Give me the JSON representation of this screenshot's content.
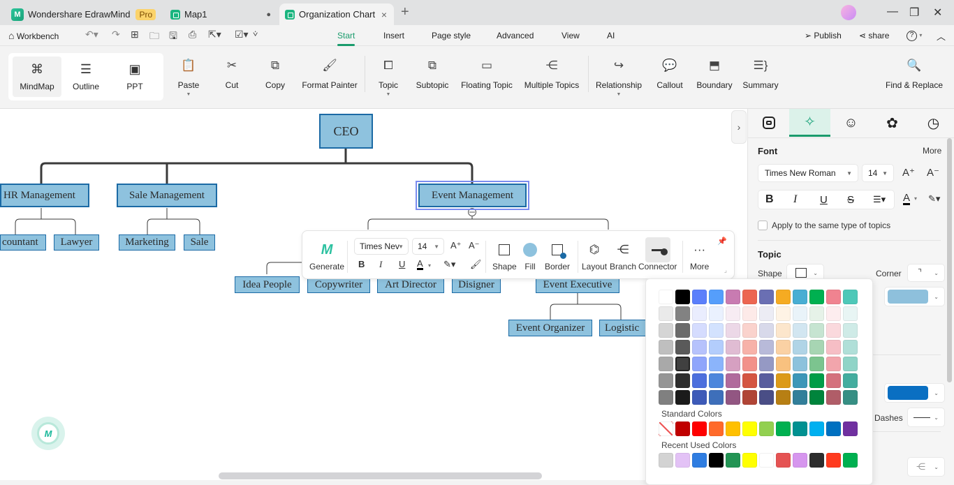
{
  "titlebar": {
    "app_name": "Wondershare EdrawMind",
    "app_badge": "Pro",
    "tabs": [
      {
        "label": "Map1",
        "unsaved_dot": "●"
      },
      {
        "label": "Organization Chart",
        "close": "×"
      }
    ],
    "new_tab": "+",
    "window": {
      "minimize": "—",
      "restore": "❐",
      "close": "✕"
    }
  },
  "menubar": {
    "workbench": "Workbench",
    "menus": [
      "Start",
      "Insert",
      "Page style",
      "Advanced",
      "View",
      "AI"
    ],
    "active_menu": "Start",
    "publish": "Publish",
    "share": "share",
    "help": "?"
  },
  "ribbon": {
    "views": [
      {
        "label": "MindMap",
        "icon": "mindmap-icon",
        "glyph": "⌘"
      },
      {
        "label": "Outline",
        "icon": "outline-icon",
        "glyph": "☰"
      },
      {
        "label": "PPT",
        "icon": "ppt-icon",
        "glyph": "▣"
      }
    ],
    "active_view": "MindMap",
    "tools": [
      {
        "label": "Paste",
        "glyph": "📋",
        "dropdown": true
      },
      {
        "label": "Cut",
        "glyph": "✂"
      },
      {
        "label": "Copy",
        "glyph": "⧉"
      },
      {
        "label": "Format Painter",
        "glyph": "🖌"
      },
      {
        "label": "Topic",
        "glyph": "⧠",
        "dropdown": true
      },
      {
        "label": "Subtopic",
        "glyph": "⧉"
      },
      {
        "label": "Floating Topic",
        "glyph": "▭"
      },
      {
        "label": "Multiple Topics",
        "glyph": "⋲"
      },
      {
        "label": "Relationship",
        "glyph": "↪",
        "dropdown": true
      },
      {
        "label": "Callout",
        "glyph": "💬"
      },
      {
        "label": "Boundary",
        "glyph": "⬒"
      },
      {
        "label": "Summary",
        "glyph": "☰}"
      },
      {
        "label": "Find & Replace",
        "glyph": "🔍"
      }
    ]
  },
  "canvas": {
    "nodes": {
      "ceo": "CEO",
      "hr": "HR Management",
      "sale_mgmt": "Sale Management",
      "event_mgmt": "Event Management",
      "accountant": "countant",
      "lawyer": "Lawyer",
      "marketing": "Marketing",
      "sale": "Sale",
      "idea_people": "Idea People",
      "copywriter": "Copywriter",
      "art_director": "Art Director",
      "designer": "Disigner",
      "event_exec": "Event Executive",
      "event_org": "Event Organizer",
      "logistic": "Logistic"
    },
    "selected_node": "Event Management"
  },
  "floating_toolbar": {
    "generate": "Generate",
    "font": "Times Nev",
    "size": "14",
    "bold": "B",
    "italic": "I",
    "underline": "U",
    "font_color": "A",
    "grow": "A⁺",
    "shrink": "A⁻",
    "shape": "Shape",
    "fill": "Fill",
    "border": "Border",
    "layout": "Layout",
    "branch": "Branch",
    "connector": "Connector",
    "more": "More",
    "more_glyph": "···"
  },
  "right_panel": {
    "font_section": {
      "title": "Font",
      "more": "More",
      "font_family": "Times New Roman",
      "font_size": "14",
      "bold": "B",
      "italic": "I",
      "underline": "U",
      "strike": "S",
      "apply_same": "Apply to the same type of topics",
      "apply_same_checked": false
    },
    "topic_section": {
      "title": "Topic",
      "shape_label": "Shape",
      "corner_label": "Corner",
      "fill_color": "#8ec0dc",
      "line_color": "#0a6fc2",
      "dashes_label": "Dashes"
    }
  },
  "color_picker": {
    "theme_colors": [
      [
        "#ffffff",
        "#000000",
        "#5b7ffb",
        "#559efb",
        "#c87bb1",
        "#ec6651",
        "#6a6fb3",
        "#f5ab22",
        "#48aed3",
        "#00b050",
        "#f08390",
        "#4ec8b8"
      ],
      [
        "#eaeaea",
        "#828282",
        "#eaedfe",
        "#eaf1fe",
        "#f7ecf3",
        "#fdeae8",
        "#ececf4",
        "#fef3e5",
        "#e9f3f9",
        "#e6f2e8",
        "#fdedef",
        "#e8f5f4"
      ],
      [
        "#d5d5d5",
        "#6b6b6b",
        "#d5dcfe",
        "#d3e2fe",
        "#ecd8e7",
        "#fad3cd",
        "#d8d9ea",
        "#fce6cc",
        "#d2e6f1",
        "#c6e4d1",
        "#fad9dd",
        "#cfebe7"
      ],
      [
        "#bfbfbf",
        "#5a5a5a",
        "#b6c2fc",
        "#b3cdfc",
        "#e0bcd3",
        "#f7b2a9",
        "#b8bad9",
        "#fad1a4",
        "#b0d4e6",
        "#a7d5b3",
        "#f6bec5",
        "#b0dfd8"
      ],
      [
        "#a9a9a9",
        "#404040",
        "#8fa5fb",
        "#8bb4fb",
        "#d6a0c1",
        "#f2918a",
        "#9599c4",
        "#f8c17f",
        "#8dc2dc",
        "#7cc48f",
        "#f2a5ac",
        "#8fd4c7"
      ],
      [
        "#959595",
        "#2d2d2d",
        "#4c6fdd",
        "#4d86dc",
        "#b06a9c",
        "#d45542",
        "#595e9e",
        "#dc9a18",
        "#3d97b8",
        "#009d48",
        "#d4717d",
        "#44ad9f"
      ],
      [
        "#808080",
        "#1b1b1b",
        "#3d5ab8",
        "#3e6fba",
        "#925682",
        "#b04536",
        "#4a4e86",
        "#b77f14",
        "#327f9a",
        "#00843c",
        "#b05d68",
        "#378f84"
      ]
    ],
    "selected_theme_color": "#404040",
    "standard_label": "Standard Colors",
    "standard_colors": [
      "none",
      "#c00000",
      "#ff0000",
      "#ff6a2a",
      "#ffc000",
      "#ffff00",
      "#92d050",
      "#00b050",
      "#009191",
      "#00b0f0",
      "#0070c0",
      "#7030a0"
    ],
    "recent_label": "Recent Used Colors",
    "recent_colors": [
      "#d3d3d3",
      "#e3c2f6",
      "#2f7de1",
      "#000000",
      "#239454",
      "#ffff00",
      "#ffffff",
      "#e55353",
      "#d696ee",
      "#2d2d2d",
      "#ff3b1f",
      "#00b050"
    ]
  }
}
